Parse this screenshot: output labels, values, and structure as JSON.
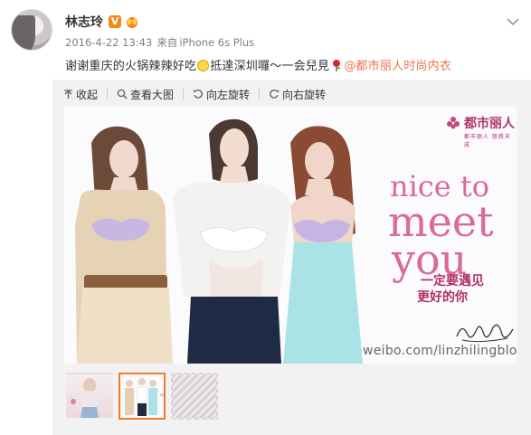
{
  "post": {
    "username": "林志玲",
    "verified_badge": "V",
    "timestamp": "2016-4-22 13:43",
    "source_prefix": "来自",
    "source_device": "iPhone 6s Plus",
    "text_part1": "谢谢重庆的火锅辣辣好吃",
    "text_part2": "抵達深圳囉～一会兒見",
    "mention": "@都市丽人时尚内衣"
  },
  "toolbar": {
    "collapse": "收起",
    "view_large": "查看大图",
    "rotate_left": "向左旋转",
    "rotate_right": "向右旋转"
  },
  "image": {
    "brand_name": "都市丽人",
    "brand_sub": "都市丽人 丽质天成",
    "headline_1": "nice to",
    "headline_2": "meet",
    "headline_3": "you",
    "slogan_1": "一定要遇见",
    "slogan_2": "更好的你",
    "watermark": "weibo.com/linzhilingblog"
  },
  "thumbnails": [
    {
      "label": "thumbnail-1",
      "active": false
    },
    {
      "label": "thumbnail-2",
      "active": true
    },
    {
      "label": "thumbnail-3",
      "active": false
    }
  ],
  "colors": {
    "accent": "#eb7350",
    "thumb_active": "#f37b22",
    "headline": "#d96a9a",
    "brand": "#b5336a"
  },
  "icons": [
    "chevron-down-icon",
    "crown-icon",
    "verified-icon",
    "collapse-icon",
    "search-icon",
    "rotate-left-icon",
    "rotate-right-icon",
    "smiley-icon",
    "rose-icon"
  ]
}
